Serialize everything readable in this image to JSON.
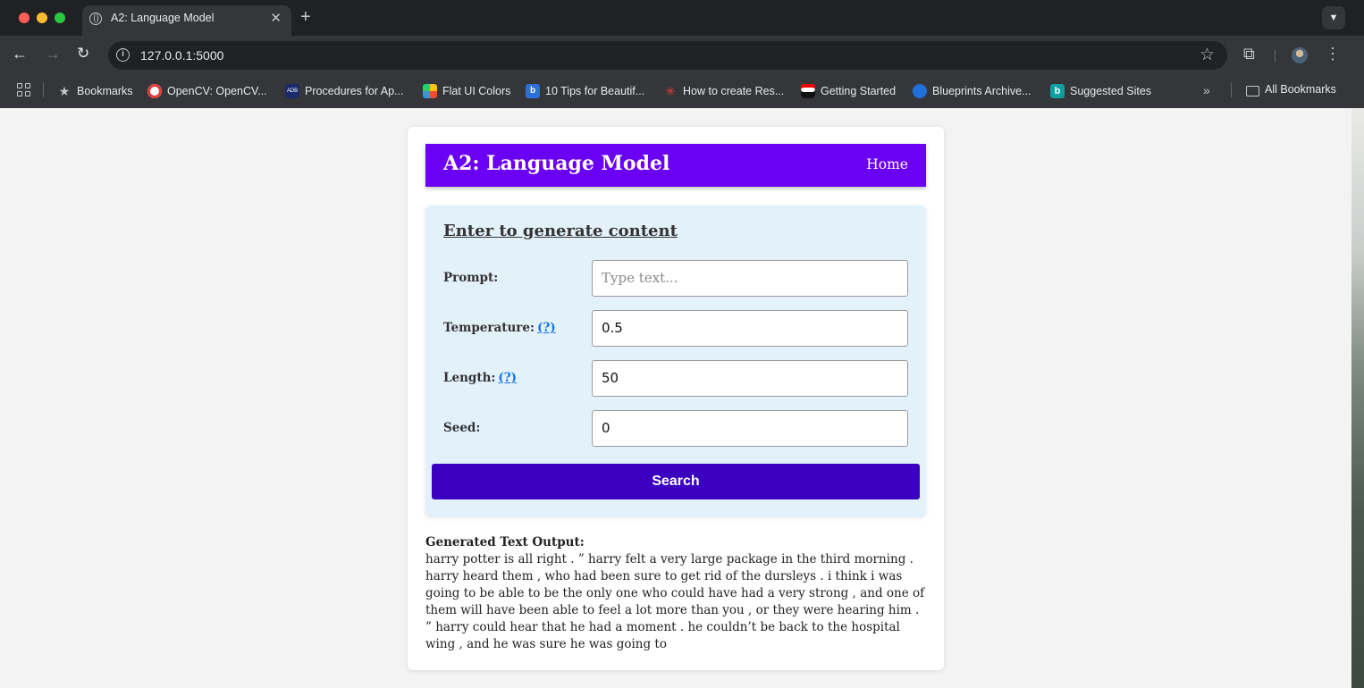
{
  "browser": {
    "tab_title": "A2: Language Model",
    "url": "127.0.0.1:5000",
    "bookmarks": [
      {
        "label": "Bookmarks",
        "icon": "star-icon"
      },
      {
        "label": "OpenCV: OpenCV...",
        "icon": "opencv-icon"
      },
      {
        "label": "Procedures for Ap...",
        "icon": "adb-icon"
      },
      {
        "label": "Flat UI Colors",
        "icon": "flat-ui-colors-icon"
      },
      {
        "label": "10 Tips for Beautif...",
        "icon": "tips-site-icon"
      },
      {
        "label": "How to create Res...",
        "icon": "red-star-icon"
      },
      {
        "label": "Getting Started",
        "icon": "redhat-icon"
      },
      {
        "label": "Blueprints Archive...",
        "icon": "blueprints-icon"
      },
      {
        "label": "Suggested Sites",
        "icon": "bing-icon"
      }
    ],
    "all_bookmarks": "All Bookmarks"
  },
  "app": {
    "title": "A2: Language Model",
    "nav_home": "Home",
    "header_color": "#6a00f4"
  },
  "form": {
    "heading": "Enter to generate content",
    "prompt_label": "Prompt:",
    "prompt_placeholder": "Type text...",
    "temperature_label": "Temperature:",
    "temperature_help": "(?)",
    "temperature_value": "0.5",
    "length_label": "Length:",
    "length_help": "(?)",
    "length_value": "50",
    "seed_label": "Seed:",
    "seed_value": "0",
    "submit_label": "Search",
    "submit_color": "#3b00c0"
  },
  "output": {
    "label": "Generated Text Output:",
    "text": "harry potter is all right . ” harry felt a very large package in the third morning . harry heard them , who had been sure to get rid of the dursleys . i think i was going to be able to be the only one who could have had a very strong , and one of them will have been able to feel a lot more than you , or they were hearing him . ” harry could hear that he had a moment . he couldn’t be back to the hospital wing , and he was sure he was going to"
  }
}
